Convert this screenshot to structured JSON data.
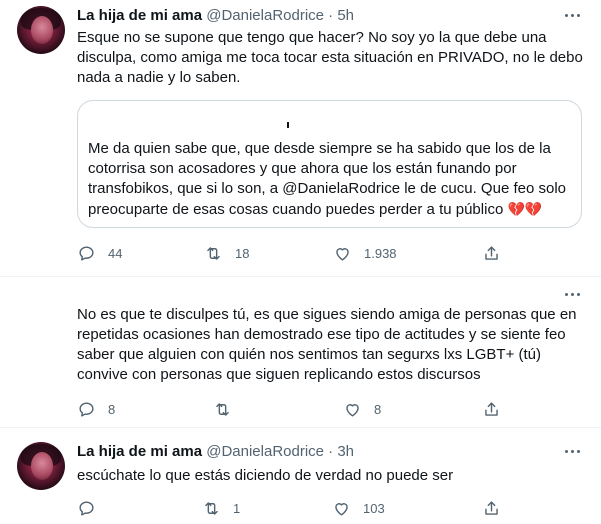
{
  "tweets": [
    {
      "display_name": "La hija de mi ama",
      "handle": "@DanielaRodrice",
      "separator": "·",
      "time": "5h",
      "text": "Esque no se supone que tengo que hacer? No soy yo la que debe una disculpa, como amiga me toca tocar esta situación en PRIVADO, no le debo nada a nadie y lo saben.",
      "quote_text": "Me da quien sabe que, que desde siempre se ha sabido que los de la cotorrisa son acosadores y que ahora que los están funando por transfobikos, que si lo son, a @DanielaRodrice le de cucu. Que feo solo preocuparte de esas cosas cuando puedes perder a tu público",
      "quote_emoji": "💔💔",
      "actions": {
        "replies": "44",
        "retweets": "18",
        "likes": "1.938"
      }
    },
    {
      "text": "No es que te disculpes tú, es que sigues siendo amiga de personas que en repetidas ocasiones han demostrado ese tipo de actitudes y se siente feo saber que alguien con quién nos sentimos tan segurxs lxs LGBT+ (tú) convive con personas que siguen replicando estos discursos",
      "actions": {
        "replies": "8",
        "retweets": "",
        "likes": "8"
      }
    },
    {
      "display_name": "La hija de mi ama",
      "handle": "@DanielaRodrice",
      "separator": "·",
      "time": "3h",
      "text": "escúchate lo que estás diciendo de verdad no puede ser",
      "actions": {
        "replies": "",
        "retweets": "1",
        "likes": "103"
      }
    }
  ],
  "icons": [
    "reply-icon",
    "retweet-icon",
    "like-icon",
    "share-icon",
    "more-icon"
  ],
  "colors": {
    "text": "#0f1419",
    "secondary": "#536471",
    "border": "#cfd9de",
    "divider": "#eff3f4"
  }
}
